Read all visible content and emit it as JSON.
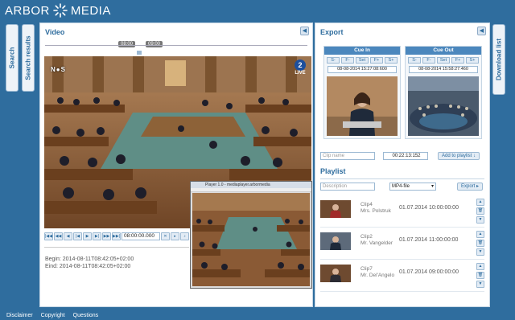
{
  "brand": {
    "left": "ARBOR",
    "right": "MEDIA"
  },
  "side_tabs": {
    "search": "Search",
    "results": "Search results",
    "download": "Download list"
  },
  "video_panel": {
    "title": "Video",
    "markers": [
      "08:00",
      "09:00"
    ],
    "channel_number": "2",
    "live_label": "LIVE",
    "nos_label": "N●S",
    "popup_title": "Player 1.0 - mediaplayer.arbormedia",
    "timecode": "08:00:00.000",
    "begin": "Begin: 2014-08-11T08:42:05+02:00",
    "end": "Eind: 2014-08-11T08:42:05+02:00"
  },
  "export": {
    "title": "Export",
    "cue_in": {
      "label": "Cue In",
      "buttons": [
        "S-",
        "F-",
        "Set",
        "F+",
        "S+"
      ],
      "time": "08-08-2014 15:27:08:600"
    },
    "cue_out": {
      "label": "Cue Out",
      "buttons": [
        "S-",
        "F-",
        "Set",
        "F+",
        "S+"
      ],
      "time": "08-08-2014 15:58:27:460"
    },
    "clip_name_placeholder": "Clip name",
    "duration": "00:22:13:152",
    "add_to_playlist": "Add to playlist ↓"
  },
  "playlist": {
    "title": "Playlist",
    "description_placeholder": "Description",
    "format": "MP4-file",
    "export_label": "Export",
    "clips": [
      {
        "name": "Clip4",
        "person": "Mrs. Polstruk",
        "date": "01.07.2014 10:00:00:00"
      },
      {
        "name": "Clip2",
        "person": "Mr. Vangelder",
        "date": "01.07.2014 11:00:00:00"
      },
      {
        "name": "Clip7",
        "person": "Mr. Del'Angelo",
        "date": "01.07.2014 09:00:00:00"
      }
    ]
  },
  "footer": {
    "links": [
      "Disclaimer",
      "Copyright",
      "Questions"
    ]
  }
}
